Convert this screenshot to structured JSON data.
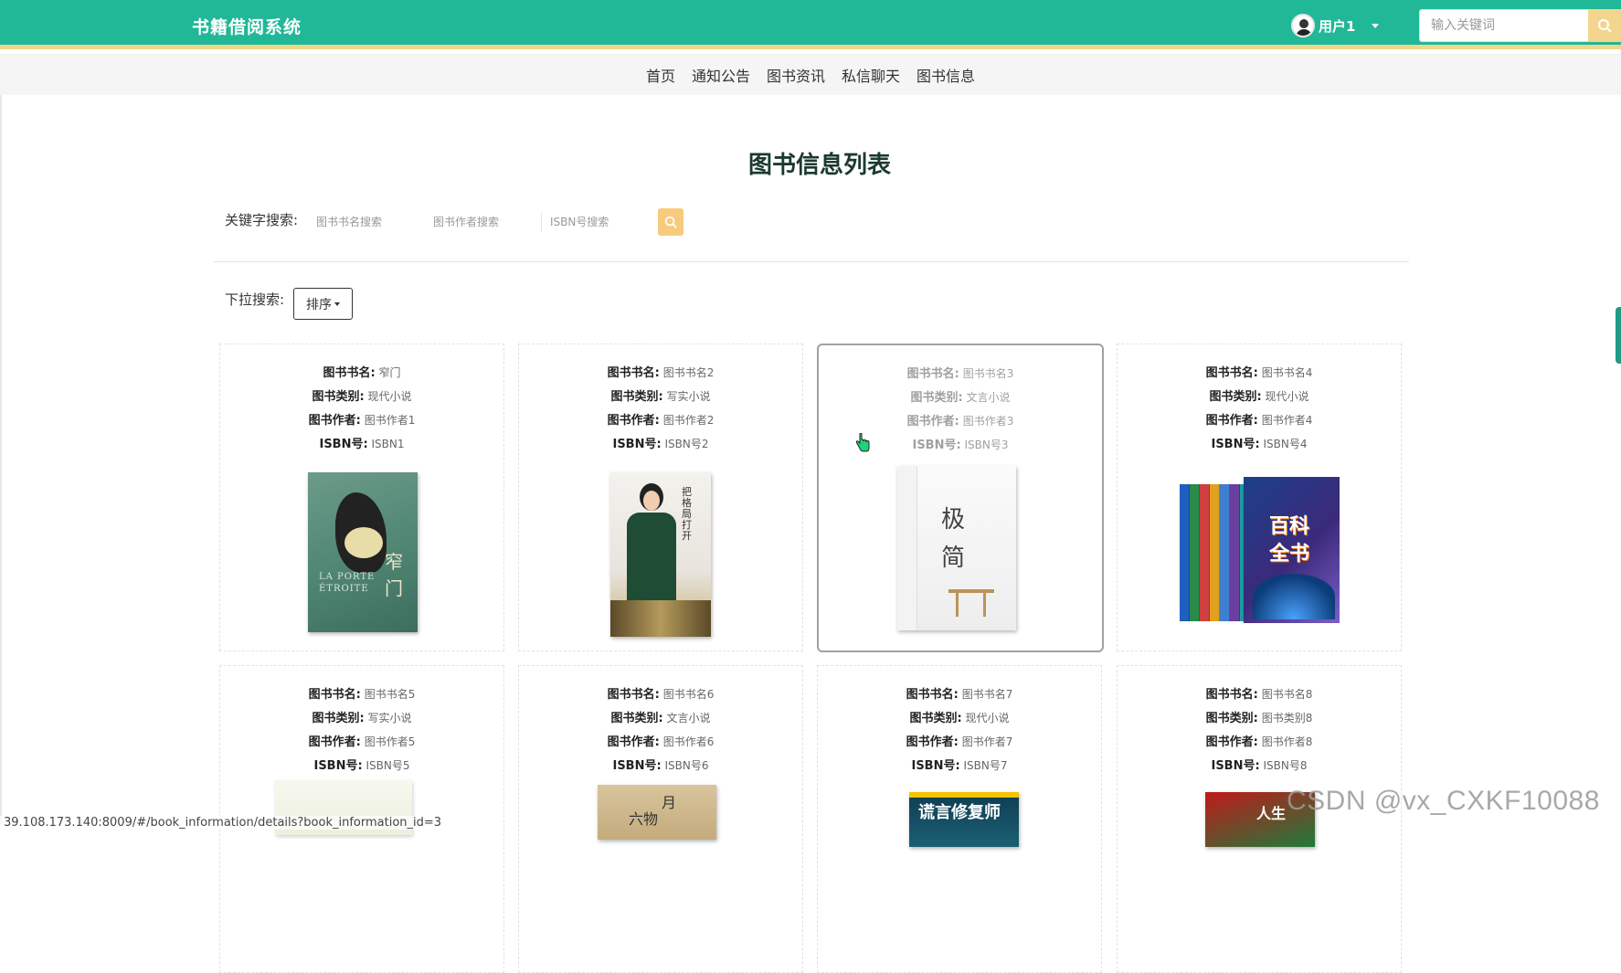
{
  "header": {
    "brand": "书籍借阅系统",
    "user_label": "用户1",
    "search_placeholder": "输入关键词"
  },
  "nav": {
    "items": [
      "首页",
      "通知公告",
      "图书资讯",
      "私信聊天",
      "图书信息"
    ]
  },
  "page": {
    "title": "图书信息列表",
    "keyword_label": "关键字搜索:",
    "name_placeholder": "图书书名搜索",
    "author_placeholder": "图书作者搜索",
    "isbn_placeholder": "ISBN号搜索",
    "dropdown_label": "下拉搜索:",
    "sort_label": "排序"
  },
  "labels": {
    "name": "图书书名:",
    "category": "图书类别:",
    "author": "图书作者:",
    "isbn": "ISBN号:"
  },
  "books": [
    {
      "name": "窄门",
      "category": "现代小说",
      "author": "图书作者1",
      "isbn": "ISBN1"
    },
    {
      "name": "图书书名2",
      "category": "写实小说",
      "author": "图书作者2",
      "isbn": "ISBN号2"
    },
    {
      "name": "图书书名3",
      "category": "文言小说",
      "author": "图书作者3",
      "isbn": "ISBN号3"
    },
    {
      "name": "图书书名4",
      "category": "现代小说",
      "author": "图书作者4",
      "isbn": "ISBN号4"
    },
    {
      "name": "图书书名5",
      "category": "写实小说",
      "author": "图书作者5",
      "isbn": "ISBN号5"
    },
    {
      "name": "图书书名6",
      "category": "文言小说",
      "author": "图书作者6",
      "isbn": "ISBN号6"
    },
    {
      "name": "图书书名7",
      "category": "现代小说",
      "author": "图书作者7",
      "isbn": "ISBN号7"
    },
    {
      "name": "图书书名8",
      "category": "图书类别8",
      "author": "图书作者8",
      "isbn": "ISBN号8"
    }
  ],
  "covers": {
    "c1_title": "LA PORTE ÉTROITE",
    "c1_zh": "窄门",
    "c2_text": "把格局打开",
    "c3_t1": "极",
    "c3_t2": "简",
    "c4_t1": "百科",
    "c4_t2": "全书",
    "c6_t1": "月",
    "c6_t2": "六物",
    "c7_t1": "谎言修复师",
    "c8_t1": "人生"
  },
  "status_url": "39.108.173.140:8009/#/book_information/details?book_information_id=3",
  "watermark": "CSDN @vx_CXKF10088",
  "colors": {
    "primary": "#20b897",
    "accent": "#f4d58d",
    "search_button": "#f7cb7d"
  }
}
